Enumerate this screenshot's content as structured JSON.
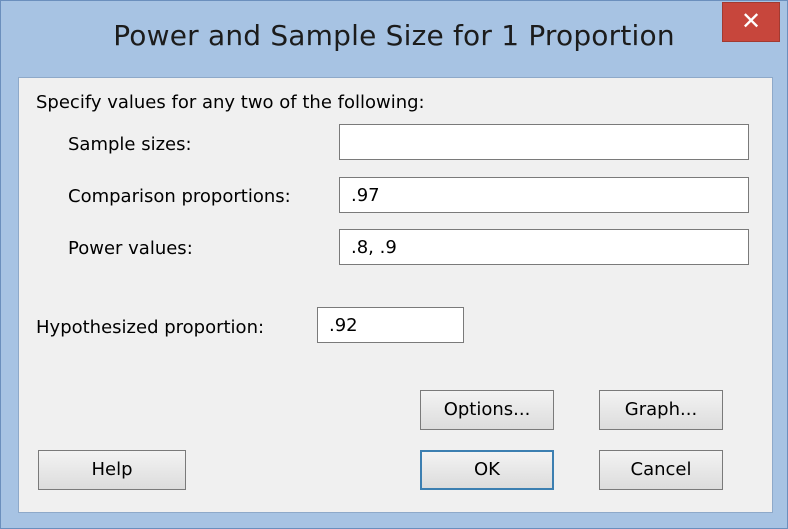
{
  "window": {
    "title": "Power and Sample Size for 1 Proportion",
    "close_glyph": "✕"
  },
  "instructions": "Specify values for any two of the following:",
  "fields": {
    "sample_sizes": {
      "label": "Sample sizes:",
      "value": ""
    },
    "comparison_proportions": {
      "label": "Comparison proportions:",
      "value": ".97"
    },
    "power_values": {
      "label": "Power values:",
      "value": ".8, .9"
    },
    "hypothesized_proportion": {
      "label": "Hypothesized proportion:",
      "value": ".92"
    }
  },
  "buttons": {
    "options": "Options...",
    "graph": "Graph...",
    "help": "Help",
    "ok": "OK",
    "cancel": "Cancel"
  },
  "colors": {
    "frame": "#a7c3e3",
    "close": "#c7463c",
    "client": "#f0f0f0",
    "default_border": "#3c7fb1"
  }
}
